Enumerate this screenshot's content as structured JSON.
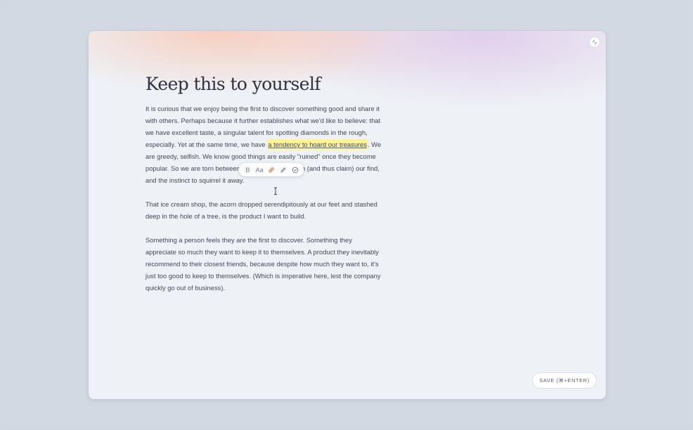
{
  "document": {
    "title": "Keep this to yourself",
    "paragraph1": {
      "part1": "It is curious that we enjoy being the first to discover something good and share it with others. Perhaps because it further establishes what we'd like to believe: that we have excellent taste, a singular talent for spotting diamonds in the rough, especially. Yet at the same time, we have ",
      "highlight": "a tendency to hoard our treasures",
      "part2": ". We are greedy, selfish. We know good things are easily \"ruined\" once they become popular. So we are torn between the desire to proclaim (and thus claim) our find, and the instinct to squirrel it away."
    },
    "paragraph2": "That ice cream shop, the acorn dropped serendipitously at our feet and stashed deep in the hole of a tree, is the product I want to build.",
    "paragraph3": "Something a person feels they are the first to discover. Something they appreciate so much they want to keep it to themselves. A product they inevitably recommend to their closest friends, because despite how much they want to, it's just too good to keep to themselves. (Which is imperative here, lest the company quickly go out of business)."
  },
  "toolbar": {
    "bold_label": "B",
    "font_size_label": "Aa",
    "icons": [
      "link-icon",
      "pen-icon",
      "check-circle-icon"
    ],
    "link_color": "#e27a3a"
  },
  "actions": {
    "save_label": "SAVE (⌘+ENTER)",
    "collapse_icon": "collapse-arrows-icon"
  },
  "colors": {
    "highlight": "#fff39a",
    "background": "#d2d8e1",
    "card": "#eef1f6"
  }
}
